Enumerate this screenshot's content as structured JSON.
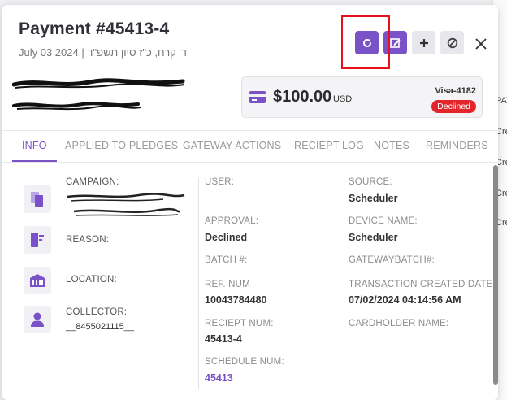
{
  "background": {
    "right_cells": [
      "PAT",
      "Cre",
      "Cre",
      "Cre",
      "Cre"
    ]
  },
  "header": {
    "title": "Payment #45413-4",
    "subtitle": "July 03 2024 | ד' קרח, כ\"ז סיון תשפ\"ד",
    "toolbar": {
      "refresh_icon": "refresh-icon",
      "edit_icon": "edit-icon",
      "add_icon": "plus-icon",
      "void_icon": "ban-icon",
      "close_icon": "close-icon"
    }
  },
  "payment": {
    "amount": "$100.00",
    "currency": "USD",
    "card": "Visa-4182",
    "status": "Declined",
    "colors": {
      "accent": "#7a52c7",
      "declined": "#e3242b"
    }
  },
  "tabs": [
    {
      "label": "INFO",
      "active": true
    },
    {
      "label": "APPLIED TO PLEDGES"
    },
    {
      "label": "GATEWAY ACTIONS"
    },
    {
      "label": "RECIEPT LOG"
    },
    {
      "label": "NOTES"
    },
    {
      "label": "REMINDERS"
    }
  ],
  "info": {
    "left": {
      "campaign_label": "CAMPAIGN:",
      "reason_label": "REASON:",
      "location_label": "LOCATION:",
      "collector_label": "COLLECTOR:",
      "collector_value": "__8455021115__"
    },
    "middle": {
      "user_label": "USER:",
      "approval_label": "APPROVAL:",
      "approval_value": "Declined",
      "batch_label": "BATCH #:",
      "ref_label": "REF. NUM",
      "ref_value": "10043784480",
      "receipt_label": "RECIEPT NUM:",
      "receipt_value": "45413-4",
      "schedule_label": "SCHEDULE NUM:",
      "schedule_value": "45413"
    },
    "right": {
      "source_label": "SOURCE:",
      "source_value": "Scheduler",
      "device_label": "DEVICE NAME:",
      "device_value": "Scheduler",
      "gatewaybatch_label": "GATEWAYBATCH#:",
      "created_label": "TRANSACTION CREATED DATE:",
      "created_value": "07/02/2024 04:14:56 AM",
      "cardholder_label": "CARDHOLDER NAME:"
    }
  }
}
